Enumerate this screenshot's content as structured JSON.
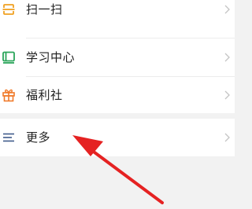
{
  "menu": {
    "items": [
      {
        "label": "扫一扫",
        "icon": "scan-icon",
        "color": "#f0a020"
      },
      {
        "label": "学习中心",
        "icon": "book-icon",
        "color": "#2aa55a"
      },
      {
        "label": "福利社",
        "icon": "gift-icon",
        "color": "#f07a2a"
      }
    ]
  },
  "more": {
    "label": "更多",
    "icon": "menu-lines-icon",
    "color": "#3e5a8a"
  },
  "annotation": {
    "arrow_color": "#e52222"
  }
}
